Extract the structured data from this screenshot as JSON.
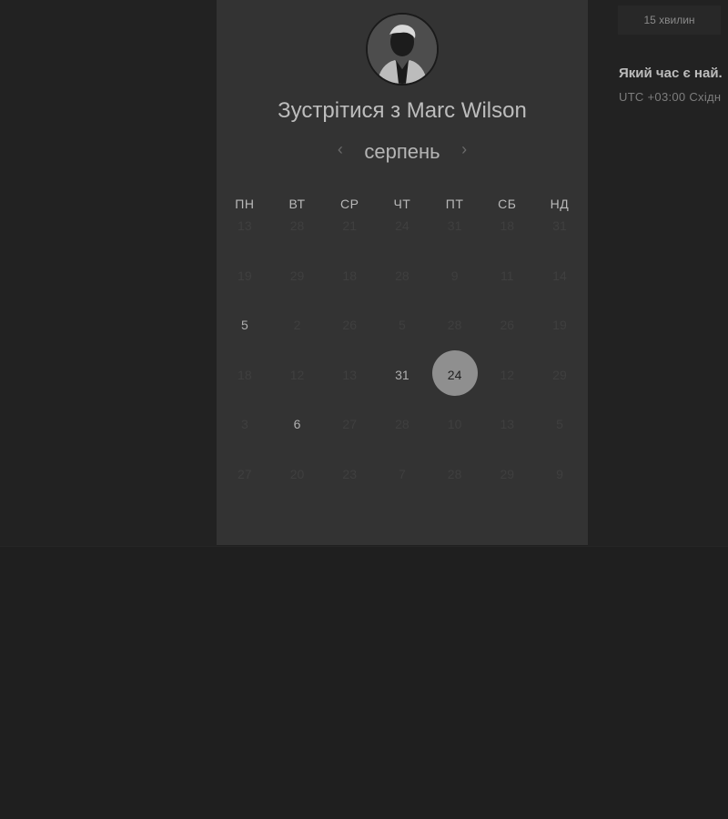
{
  "panel": {
    "title": "Зустрітися з Marc Wilson",
    "month": "серпень",
    "prev_icon": "chevron-left-icon",
    "next_icon": "chevron-right-icon",
    "prev_symbol": "‹",
    "next_symbol": "›",
    "weekdays": [
      "ПН",
      "ВТ",
      "СР",
      "ЧТ",
      "ПТ",
      "СБ",
      "НД"
    ],
    "weeks": [
      [
        "13",
        "28",
        "21",
        "24",
        "31",
        "18",
        "31"
      ],
      [
        "19",
        "29",
        "18",
        "28",
        "9",
        "11",
        "14"
      ],
      [
        "5",
        "2",
        "26",
        "5",
        "28",
        "26",
        "19"
      ],
      [
        "18",
        "12",
        "13",
        "31",
        "24",
        "12",
        "29"
      ],
      [
        "3",
        "6",
        "27",
        "28",
        "10",
        "13",
        "5"
      ],
      [
        "27",
        "20",
        "23",
        "7",
        "28",
        "29",
        "9"
      ]
    ]
  },
  "side": {
    "duration": "15 хвилин",
    "question": "Який час є най.",
    "timezone": "UTC +03:00 Східн"
  },
  "colors": {
    "panel_bg": "#333333",
    "page_bg": "#1f1f1f",
    "selected_day_bg": "#8f8f8f"
  }
}
